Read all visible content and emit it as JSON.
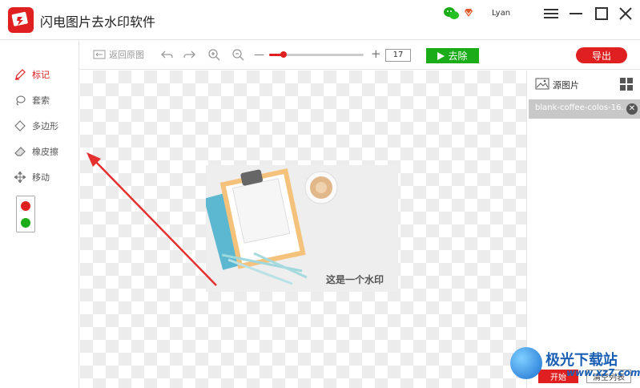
{
  "app": {
    "title": "闪电图片去水印软件",
    "username": "Lyan"
  },
  "toolbar": {
    "restore_label": "返回原图",
    "zoom_value": "17",
    "slider_level_percent": 15,
    "remove_label": "去除",
    "export_label": "导出",
    "zoom_minus": "—",
    "zoom_plus": "+"
  },
  "tools": [
    {
      "label": "标记",
      "icon": "pen-icon",
      "active": true
    },
    {
      "label": "套索",
      "icon": "lasso-icon",
      "active": false
    },
    {
      "label": "多边形",
      "icon": "polygon-icon",
      "active": false
    },
    {
      "label": "橡皮擦",
      "icon": "eraser-icon",
      "active": false
    },
    {
      "label": "移动",
      "icon": "move-icon",
      "active": false
    }
  ],
  "colors": {
    "red": "#e02020",
    "green": "#1aad19"
  },
  "canvas": {
    "watermark": "这是一个水印"
  },
  "right_panel": {
    "title": "源图片",
    "files": [
      "blank-coffee-colos-16..."
    ],
    "start_label": "开始",
    "clear_label": "清空列表"
  },
  "site_mark": {
    "name": "极光下载站",
    "url": "www.xz7.com"
  }
}
